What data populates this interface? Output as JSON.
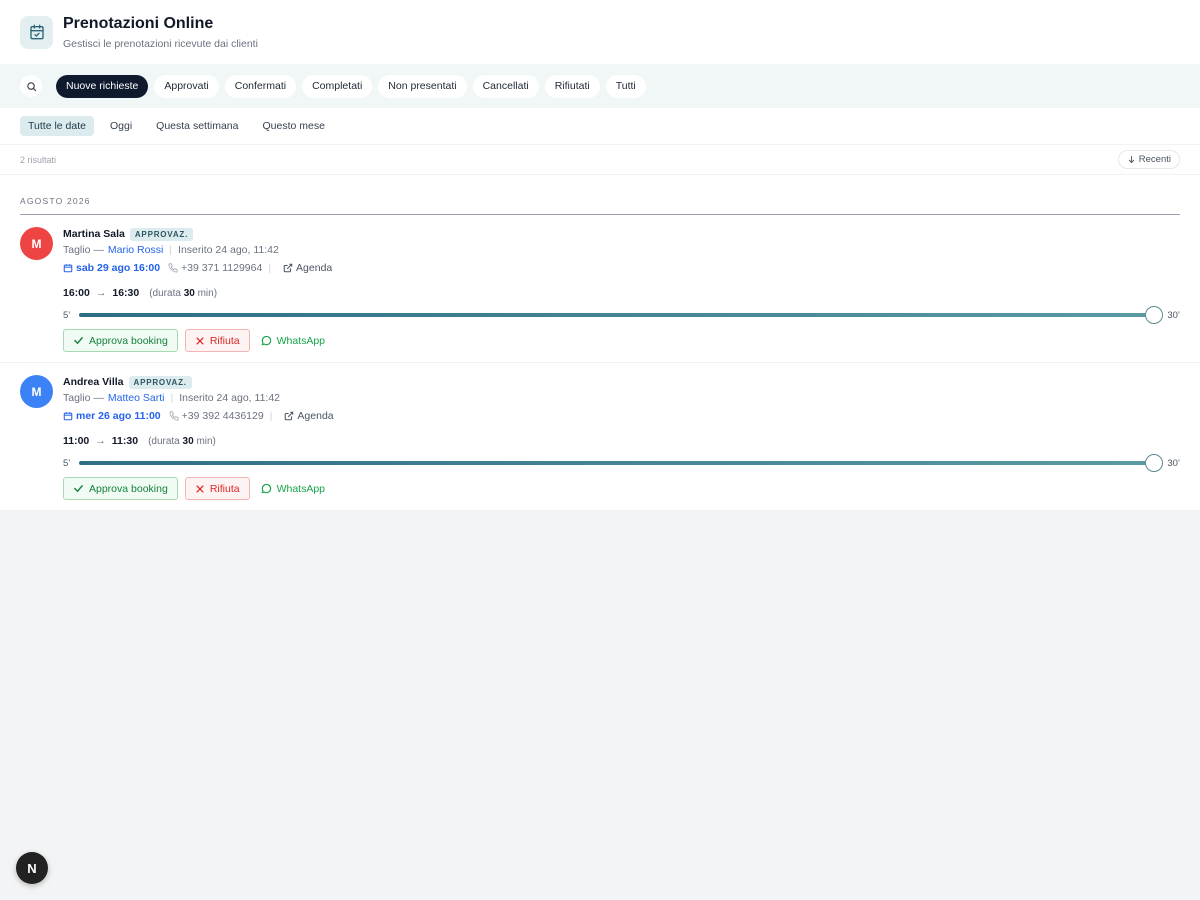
{
  "header": {
    "title": "Prenotazioni Online",
    "subtitle": "Gestisci le prenotazioni ricevute dai clienti",
    "icon": "calendar-check-icon"
  },
  "status_tabs": [
    {
      "label": "Nuove richieste",
      "active": true
    },
    {
      "label": "Approvati",
      "active": false
    },
    {
      "label": "Confermati",
      "active": false
    },
    {
      "label": "Completati",
      "active": false
    },
    {
      "label": "Non presentati",
      "active": false
    },
    {
      "label": "Cancellati",
      "active": false
    },
    {
      "label": "Rifiutati",
      "active": false
    },
    {
      "label": "Tutti",
      "active": false
    }
  ],
  "date_filters": [
    {
      "label": "Tutte le date",
      "active": true
    },
    {
      "label": "Oggi",
      "active": false
    },
    {
      "label": "Questa settimana",
      "active": false
    },
    {
      "label": "Questo mese",
      "active": false
    }
  ],
  "results": {
    "count_label": "2 risultati",
    "sort_label": "Recenti"
  },
  "month_group": "AGOSTO 2026",
  "bookings": [
    {
      "initial": "M",
      "avatar_color": "#ef4444",
      "client": "Martina Sala",
      "badge": "APPROVAZ.",
      "service": "Taglio —",
      "staff": "Mario Rossi",
      "inserted": "Inserito 24 ago, 11:42",
      "date": "sab 29 ago 16:00",
      "phone": "+39 371 1129964",
      "agenda_label": "Agenda",
      "start": "16:00",
      "end": "16:30",
      "duration_prefix": "(durata",
      "duration_value": "30",
      "duration_suffix": "min)",
      "slider_min": "5’",
      "slider_max": "30’",
      "slider_value": 30,
      "approve_label": "Approva booking",
      "reject_label": "Rifiuta",
      "whatsapp_label": "WhatsApp"
    },
    {
      "initial": "M",
      "avatar_color": "#3b82f6",
      "client": "Andrea Villa",
      "badge": "APPROVAZ.",
      "service": "Taglio —",
      "staff": "Matteo Sarti",
      "inserted": "Inserito 24 ago, 11:42",
      "date": "mer 26 ago 11:00",
      "phone": "+39 392 4436129",
      "agenda_label": "Agenda",
      "start": "11:00",
      "end": "11:30",
      "duration_prefix": "(durata",
      "duration_value": "30",
      "duration_suffix": "min)",
      "slider_min": "5’",
      "slider_max": "30’",
      "slider_value": 30,
      "approve_label": "Approva booking",
      "reject_label": "Rifiuta",
      "whatsapp_label": "WhatsApp"
    }
  ],
  "slider_range": [
    5,
    30
  ],
  "dev_badge": "N",
  "colors": {
    "accent_dark": "#0f1a2e",
    "date_link": "#2563eb",
    "approve": "#15803d",
    "reject": "#dc2626",
    "whatsapp": "#16a34a"
  }
}
